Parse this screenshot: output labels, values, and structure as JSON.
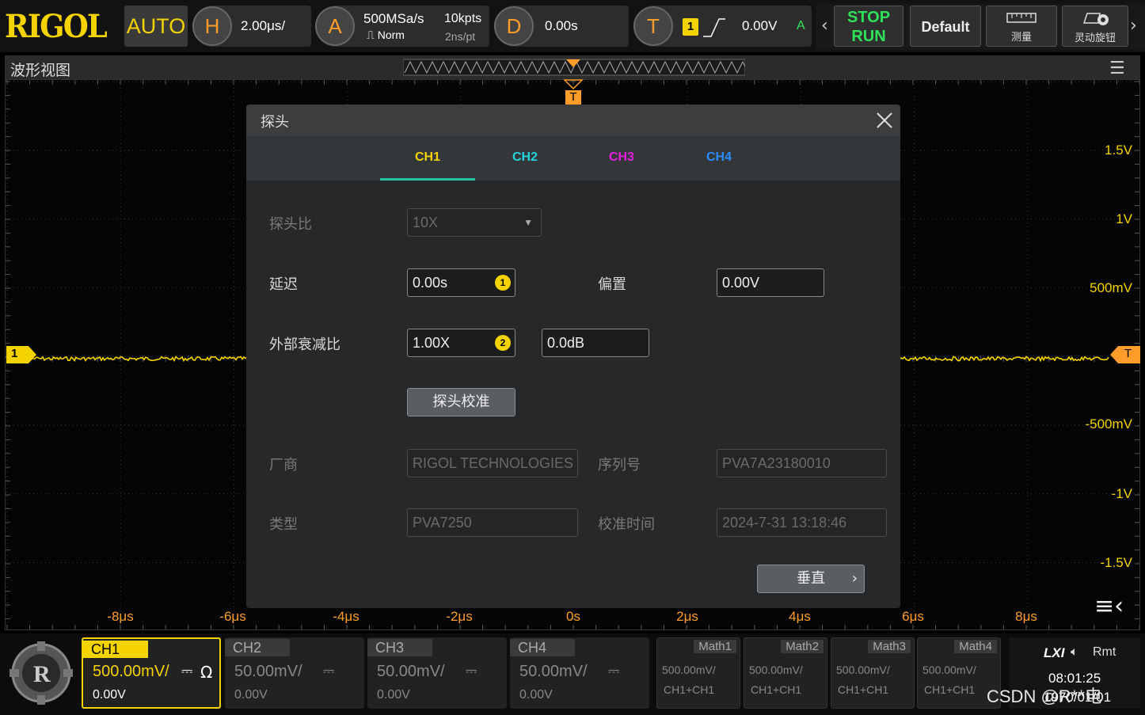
{
  "topbar": {
    "logo": "RIGOL",
    "auto": "AUTO",
    "h_icon": "H",
    "timebase": "2.00μs/",
    "a_icon": "A",
    "sample_rate": "500MSa/s",
    "acq_mode": "Norm",
    "mem_depth": "10kpts",
    "pts_time": "2ns/pt",
    "d_icon": "D",
    "delay": "0.00s",
    "t_icon": "T",
    "trig_src": "1",
    "trig_level": "0.00V",
    "trig_mode": "A",
    "stop": "STOP",
    "run": "RUN",
    "default": "Default",
    "measure": "测量",
    "knob": "灵动旋钮"
  },
  "wave": {
    "title": "波形视图",
    "trigger_marker": "T",
    "ch1_marker": "1",
    "trig_level_marker": "T",
    "y_labels": [
      "1.5V",
      "1V",
      "500mV",
      "-500mV",
      "-1V",
      "-1.5V"
    ],
    "x_labels": [
      "-8μs",
      "-6μs",
      "-4μs",
      "-2μs",
      "0s",
      "2μs",
      "4μs",
      "6μs",
      "8μs"
    ]
  },
  "dialog": {
    "title": "探头",
    "tabs": [
      "CH1",
      "CH2",
      "CH3",
      "CH4"
    ],
    "tab_colors": [
      "#f5d300",
      "#22d3e0",
      "#e81ee0",
      "#2b8cff"
    ],
    "probe_ratio_label": "探头比",
    "probe_ratio": "10X",
    "delay_label": "延迟",
    "delay_value": "0.00s",
    "delay_badge": "1",
    "offset_label": "偏置",
    "offset_value": "0.00V",
    "atten_label": "外部衰减比",
    "atten_value": "1.00X",
    "atten_badge": "2",
    "atten_db": "0.0dB",
    "calibrate": "探头校准",
    "vendor_label": "厂商",
    "vendor": "RIGOL TECHNOLOGIES",
    "serial_label": "序列号",
    "serial": "PVA7A23180010",
    "type_label": "类型",
    "type": "PVA7250",
    "cal_time_label": "校准时间",
    "cal_time": "2024-7-31 13:18:46",
    "vertical": "垂直"
  },
  "channels": [
    {
      "name": "CH1",
      "scale": "500.00mV/",
      "coupling": "⎓",
      "imp": "Ω",
      "offset": "0.00V"
    },
    {
      "name": "CH2",
      "scale": "50.00mV/",
      "coupling": "⎓",
      "offset": "0.00V"
    },
    {
      "name": "CH3",
      "scale": "50.00mV/",
      "coupling": "⎓",
      "offset": "0.00V"
    },
    {
      "name": "CH4",
      "scale": "50.00mV/",
      "coupling": "⎓",
      "offset": "0.00V"
    }
  ],
  "maths": [
    {
      "name": "Math1",
      "scale": "500.00mV/",
      "src": "CH1+CH1"
    },
    {
      "name": "Math2",
      "scale": "500.00mV/",
      "src": "CH1+CH1"
    },
    {
      "name": "Math3",
      "scale": "500.00mV/",
      "src": "CH1+CH1"
    },
    {
      "name": "Math4",
      "scale": "500.00mV/",
      "src": "CH1+CH1"
    }
  ],
  "status": {
    "lxi": "LXI",
    "rmt": "Rmt",
    "time": "08:01:25",
    "date": "1970/01/01",
    "watermark": "CSDN @R**电"
  },
  "colors": {
    "ch1": "#f5d300",
    "accent_orange": "#ff9d2a",
    "green": "#2ee35a"
  }
}
